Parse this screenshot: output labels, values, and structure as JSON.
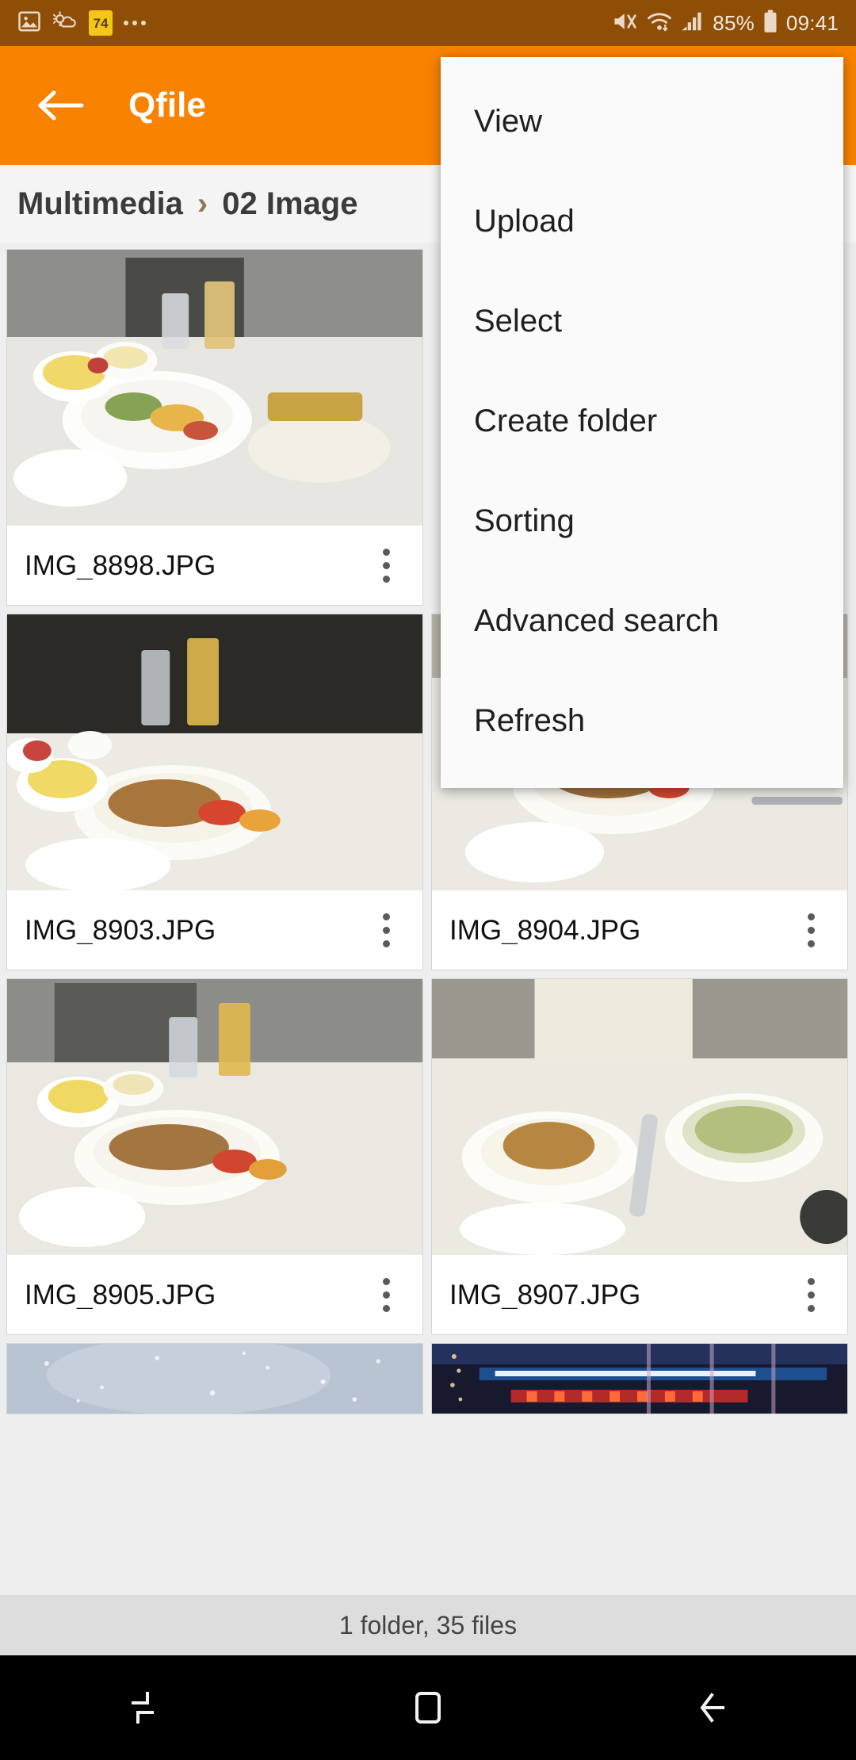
{
  "status_bar": {
    "icons": [
      "image-icon",
      "weather-icon",
      "calendar-badge-icon",
      "more-dots-icon"
    ],
    "badge_value": "74",
    "mute_icon": "mute-icon",
    "wifi_icon": "wifi-icon",
    "signal_icon": "signal-icon",
    "battery_percent": "85%",
    "battery_icon": "battery-icon",
    "clock": "09:41",
    "background": "#8f4e06",
    "text_color": "#f2e8dd"
  },
  "app_bar": {
    "back_label": "back-arrow",
    "title": "Qfile",
    "background": "#f98200"
  },
  "breadcrumb": {
    "root": "Multimedia",
    "separator": "›",
    "current": "02 Image"
  },
  "grid": {
    "files": [
      {
        "name": "IMG_8898.JPG",
        "kebab": "more-options-icon",
        "scene": "meal-tray-a"
      },
      {
        "name": "IMG_8903.JPG",
        "kebab": "more-options-icon",
        "scene": "meal-tray-b"
      },
      {
        "name": "IMG_8904.JPG",
        "kebab": "more-options-icon",
        "scene": "meal-tray-c"
      },
      {
        "name": "IMG_8905.JPG",
        "kebab": "more-options-icon",
        "scene": "meal-tray-d"
      },
      {
        "name": "IMG_8907.JPG",
        "kebab": "more-options-icon",
        "scene": "soup-bowl"
      }
    ],
    "partial_row": [
      {
        "scene": "snow-sky"
      },
      {
        "scene": "night-city"
      }
    ]
  },
  "footer": {
    "count_text": "1 folder, 35 files",
    "background": "#dddddd"
  },
  "menu": {
    "items": [
      {
        "label": "View"
      },
      {
        "label": "Upload"
      },
      {
        "label": "Select"
      },
      {
        "label": "Create folder"
      },
      {
        "label": "Sorting"
      },
      {
        "label": "Advanced search"
      },
      {
        "label": "Refresh"
      }
    ],
    "background": "#fafafa"
  },
  "nav_bar": {
    "buttons": [
      "recents-button",
      "home-button",
      "back-button"
    ],
    "background": "#000000"
  }
}
